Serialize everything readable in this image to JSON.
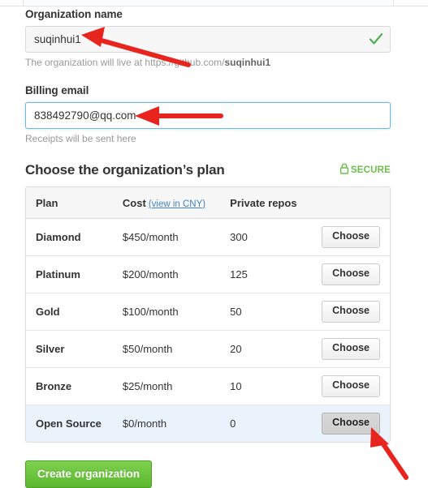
{
  "org_name": {
    "label": "Organization name",
    "value": "suqinhui1",
    "valid_icon": "check-icon",
    "help_prefix": "The organization will live at https://github.com/",
    "help_bold": "suqinhui1"
  },
  "billing_email": {
    "label": "Billing email",
    "value": "838492790@qq.com",
    "help": "Receipts will be sent here"
  },
  "plans_section": {
    "title": "Choose the organization’s plan",
    "secure_label": "SECURE",
    "secure_icon": "lock-icon",
    "secure_color": "#6cbf4b"
  },
  "plan_table": {
    "columns": [
      "Plan",
      "Cost",
      "Private repos",
      ""
    ],
    "cost_link": "(view in CNY)",
    "cost_link_color": "#4183c4",
    "action_label": "Choose",
    "rows": [
      {
        "plan": "Diamond",
        "cost": "$450/month",
        "repos": "300",
        "action": "Choose",
        "selected": false,
        "button_active": false
      },
      {
        "plan": "Platinum",
        "cost": "$200/month",
        "repos": "125",
        "action": "Choose",
        "selected": false,
        "button_active": false
      },
      {
        "plan": "Gold",
        "cost": "$100/month",
        "repos": "50",
        "action": "Choose",
        "selected": false,
        "button_active": false
      },
      {
        "plan": "Silver",
        "cost": "$50/month",
        "repos": "20",
        "action": "Choose",
        "selected": false,
        "button_active": false
      },
      {
        "plan": "Bronze",
        "cost": "$25/month",
        "repos": "10",
        "action": "Choose",
        "selected": false,
        "button_active": false
      },
      {
        "plan": "Open Source",
        "cost": "$0/month",
        "repos": "0",
        "action": "Choose",
        "selected": true,
        "button_active": true
      }
    ]
  },
  "submit": {
    "label": "Create organization"
  },
  "annotations": {
    "arrow_color": "#e8241f",
    "count": 3
  }
}
